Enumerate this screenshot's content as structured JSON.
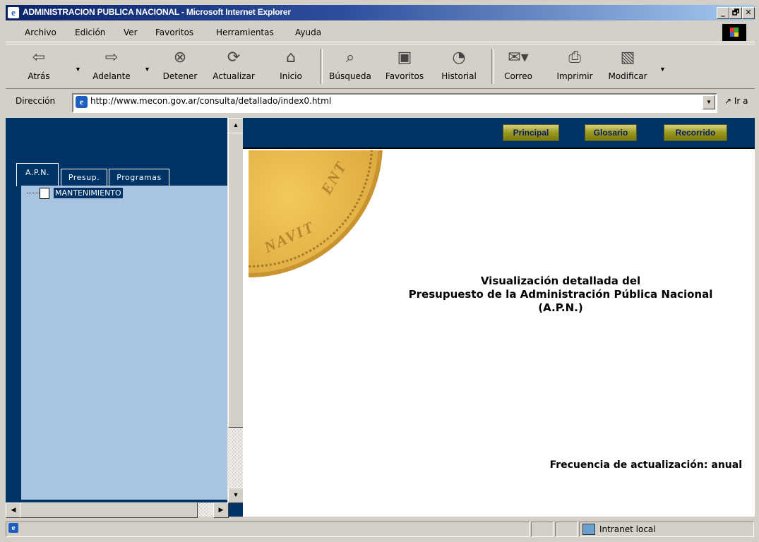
{
  "window": {
    "title": "ADMINISTRACION PUBLICA NACIONAL - Microsoft Internet Explorer",
    "controls": [
      "_",
      "🗗",
      "✕"
    ]
  },
  "menubar": {
    "items": [
      "Archivo",
      "Edición",
      "Ver",
      "Favoritos",
      "Herramientas",
      "Ayuda"
    ]
  },
  "toolbar": {
    "back": "Atrás",
    "forward": "Adelante",
    "stop": "Detener",
    "refresh": "Actualizar",
    "home": "Inicio",
    "search": "Búsqueda",
    "favorites": "Favoritos",
    "history": "Historial",
    "mail": "Correo",
    "print": "Imprimir",
    "edit": "Modificar"
  },
  "address": {
    "label": "Dirección",
    "url": "http://www.mecon.gov.ar/consulta/detallado/index0.html",
    "go": "Ir a"
  },
  "left": {
    "tabs": [
      "A.P.N.",
      "Presup.",
      "Programas"
    ],
    "tree_item": "MANTENIMIENTO"
  },
  "nav": {
    "principal": "Principal",
    "glosario": "Glosario",
    "recorrido": "Recorrido"
  },
  "main": {
    "title_line1": "Visualización detallada del",
    "title_line2": "Presupuesto de la Administración Pública Nacional",
    "title_line3": "(A.P.N.)",
    "frequency": "Frecuencia de actualización: anual"
  },
  "status": {
    "zone": "Intranet local"
  },
  "colors": {
    "frame_bg": "#003366",
    "tree_bg": "#a8c4e0",
    "title_gradient_start": "#0a246a"
  }
}
